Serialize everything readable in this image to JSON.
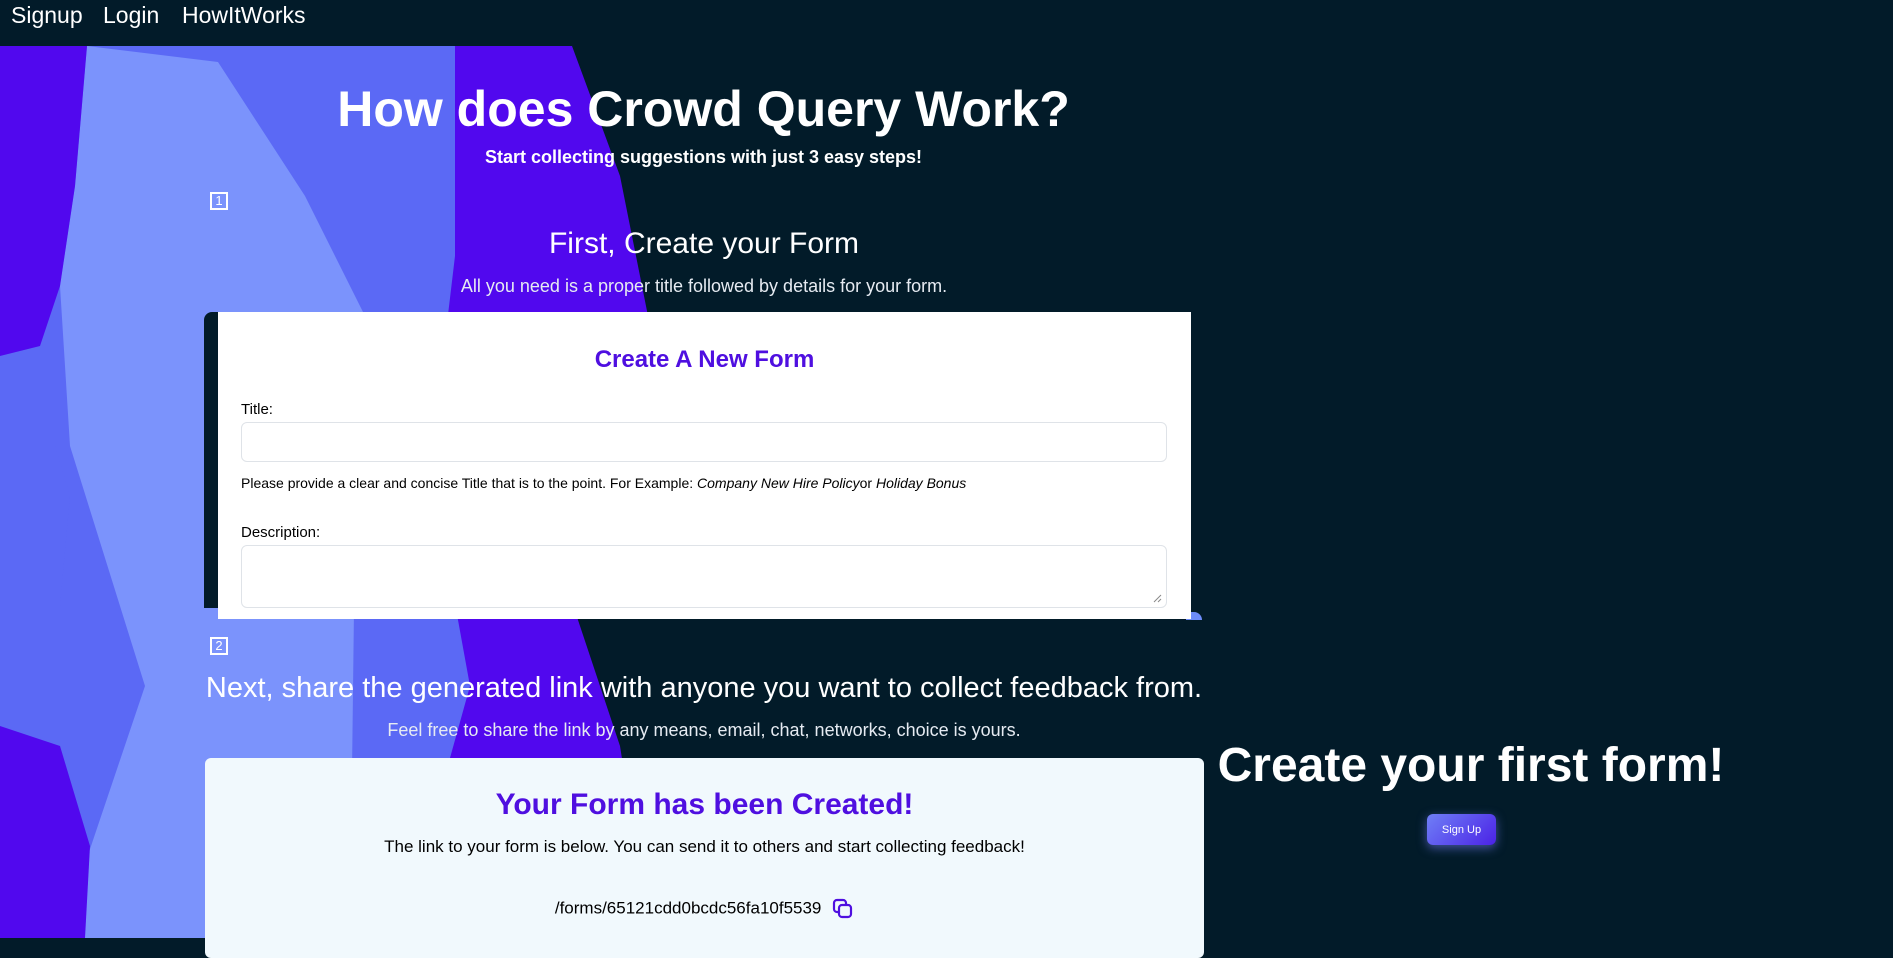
{
  "nav": {
    "signup": "Signup",
    "login": "Login",
    "how_it_works": "HowItWorks"
  },
  "hero": {
    "title": "How does Crowd Query Work?",
    "subtitle": "Start collecting suggestions with just 3 easy steps!"
  },
  "steps": [
    {
      "number": "1",
      "title": "First, Create your Form",
      "description": "All you need is a proper title followed by details for your form."
    },
    {
      "number": "2",
      "title": "Next, share the generated link with anyone you want to collect feedback from.",
      "description": "Feel free to share the link by any means, email, chat, networks, choice is yours."
    }
  ],
  "create_form_card": {
    "heading": "Create A New Form",
    "title_label": "Title:",
    "title_value": "",
    "hint_prefix": "Please provide a clear and concise Title that is to the point. For Example: ",
    "hint_example_1": "Company New Hire Policy",
    "hint_or": "or",
    "hint_example_2": " Holiday Bonus",
    "description_label": "Description:",
    "description_value": ""
  },
  "created_card": {
    "heading": "Your Form has been Created!",
    "description": "The link to your form is below. You can send it to others and start collecting feedback!",
    "link": "/forms/65121cdd0bcdc56fa10f5539",
    "copy_icon": "copy-icon"
  },
  "cta": {
    "title": "Create your first form!",
    "button_label": "Sign Up"
  },
  "colors": {
    "page_background": "#021b29",
    "accent_purple": "#4f0fe0",
    "shape_dark": "#5108ee",
    "shape_mid": "#5b69f5",
    "shape_light": "#7b93fc"
  }
}
